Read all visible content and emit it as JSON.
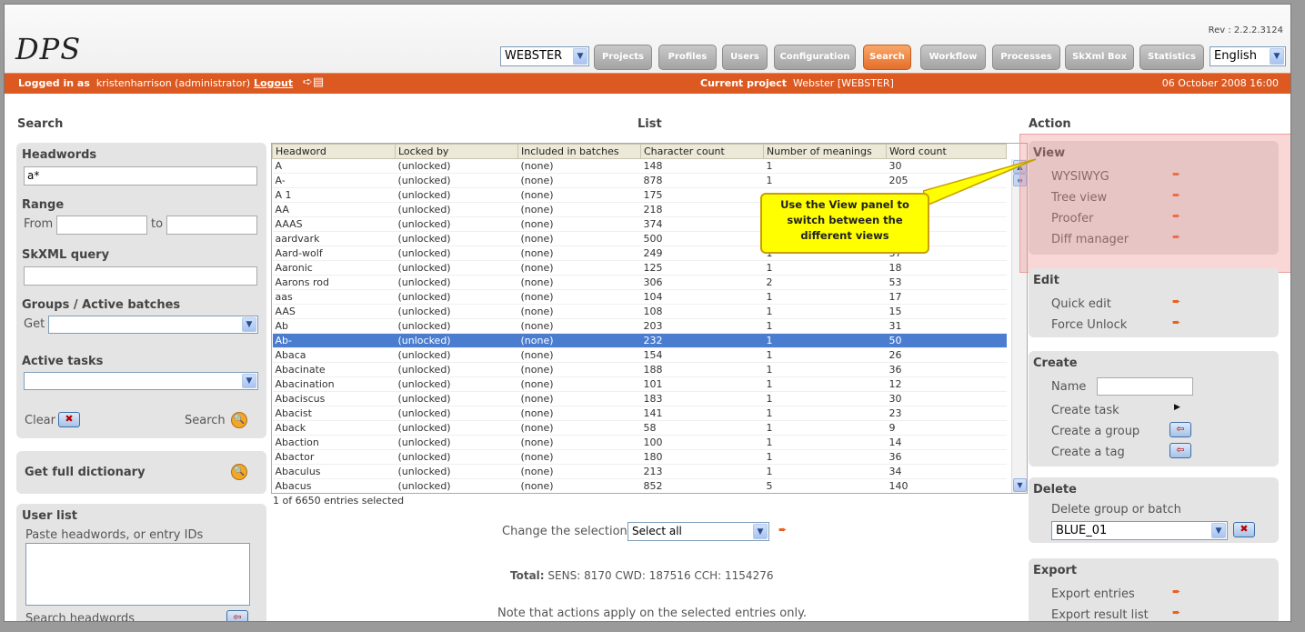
{
  "header": {
    "logo": "DPS",
    "rev": "Rev : 2.2.2.3124",
    "project_select": "WEBSTER",
    "language_select": "English",
    "nav": [
      "Projects",
      "Profiles",
      "Users",
      "Configuration",
      "Search",
      "Workflow",
      "Processes",
      "SkXml Box",
      "Statistics"
    ],
    "active_nav": "Search"
  },
  "bar": {
    "logged_in_label": "Logged in as",
    "user": "kristenharrison (administrator)",
    "logout": "Logout",
    "current_project_label": "Current project",
    "current_project": "Webster [WEBSTER]",
    "datetime": "06 October 2008 16:00"
  },
  "titles": {
    "search": "Search",
    "list": "List",
    "action": "Action"
  },
  "search": {
    "headwords_label": "Headwords",
    "headwords_value": "a*",
    "range_label": "Range",
    "from_label": "From",
    "to_label": "to",
    "skxml_label": "SkXML query",
    "groups_label": "Groups / Active batches",
    "get_label": "Get",
    "active_tasks_label": "Active tasks",
    "clear_label": "Clear",
    "search_label": "Search",
    "full_dict_label": "Get full dictionary",
    "user_list_label": "User list",
    "paste_label": "Paste headwords, or entry IDs",
    "search_headwords_label": "Search headwords"
  },
  "list": {
    "columns": [
      "Headword",
      "Locked by",
      "Included in batches",
      "Character count",
      "Number of meanings",
      "Word count"
    ],
    "rows": [
      [
        "A",
        "(unlocked)",
        "(none)",
        "148",
        "1",
        "30"
      ],
      [
        "A-",
        "(unlocked)",
        "(none)",
        "878",
        "1",
        "205"
      ],
      [
        "A 1",
        "(unlocked)",
        "(none)",
        "175",
        "",
        ""
      ],
      [
        "AA",
        "(unlocked)",
        "(none)",
        "218",
        "",
        ""
      ],
      [
        "AAAS",
        "(unlocked)",
        "(none)",
        "374",
        "",
        ""
      ],
      [
        "aardvark",
        "(unlocked)",
        "(none)",
        "500",
        "",
        ""
      ],
      [
        "Aard-wolf",
        "(unlocked)",
        "(none)",
        "249",
        "1",
        "37"
      ],
      [
        "Aaronic",
        "(unlocked)",
        "(none)",
        "125",
        "1",
        "18"
      ],
      [
        "Aarons rod",
        "(unlocked)",
        "(none)",
        "306",
        "2",
        "53"
      ],
      [
        "aas",
        "(unlocked)",
        "(none)",
        "104",
        "1",
        "17"
      ],
      [
        "AAS",
        "(unlocked)",
        "(none)",
        "108",
        "1",
        "15"
      ],
      [
        "Ab",
        "(unlocked)",
        "(none)",
        "203",
        "1",
        "31"
      ],
      [
        "Ab-",
        "(unlocked)",
        "(none)",
        "232",
        "1",
        "50"
      ],
      [
        "Abaca",
        "(unlocked)",
        "(none)",
        "154",
        "1",
        "26"
      ],
      [
        "Abacinate",
        "(unlocked)",
        "(none)",
        "188",
        "1",
        "36"
      ],
      [
        "Abacination",
        "(unlocked)",
        "(none)",
        "101",
        "1",
        "12"
      ],
      [
        "Abaciscus",
        "(unlocked)",
        "(none)",
        "183",
        "1",
        "30"
      ],
      [
        "Abacist",
        "(unlocked)",
        "(none)",
        "141",
        "1",
        "23"
      ],
      [
        "Aback",
        "(unlocked)",
        "(none)",
        "58",
        "1",
        "9"
      ],
      [
        "Abaction",
        "(unlocked)",
        "(none)",
        "100",
        "1",
        "14"
      ],
      [
        "Abactor",
        "(unlocked)",
        "(none)",
        "180",
        "1",
        "36"
      ],
      [
        "Abaculus",
        "(unlocked)",
        "(none)",
        "213",
        "1",
        "34"
      ],
      [
        "Abacus",
        "(unlocked)",
        "(none)",
        "852",
        "5",
        "140"
      ]
    ],
    "selected_row": 12,
    "status": "1 of 6650 entries selected",
    "change_selection_label": "Change the selection",
    "change_selection_value": "Select all",
    "total_label": "Total:",
    "total_value": "SENS: 8170 CWD: 187516 CCH: 1154276",
    "note": "Note that actions apply on the selected entries only."
  },
  "callout": "Use the View panel to switch between the different views",
  "action": {
    "view_title": "View",
    "view_items": [
      "WYSIWYG",
      "Tree view",
      "Proofer",
      "Diff manager"
    ],
    "edit_title": "Edit",
    "edit_items": [
      "Quick edit",
      "Force Unlock"
    ],
    "create_title": "Create",
    "name_label": "Name",
    "create_task": "Create task",
    "create_group": "Create a group",
    "create_tag": "Create a tag",
    "delete_title": "Delete",
    "delete_label": "Delete group or batch",
    "delete_value": "BLUE_01",
    "export_title": "Export",
    "export_entries": "Export entries",
    "export_result": "Export result list"
  },
  "colors": {
    "accent": "#dc5a22",
    "selection": "#4a7dd0",
    "callout": "#ffff00"
  }
}
